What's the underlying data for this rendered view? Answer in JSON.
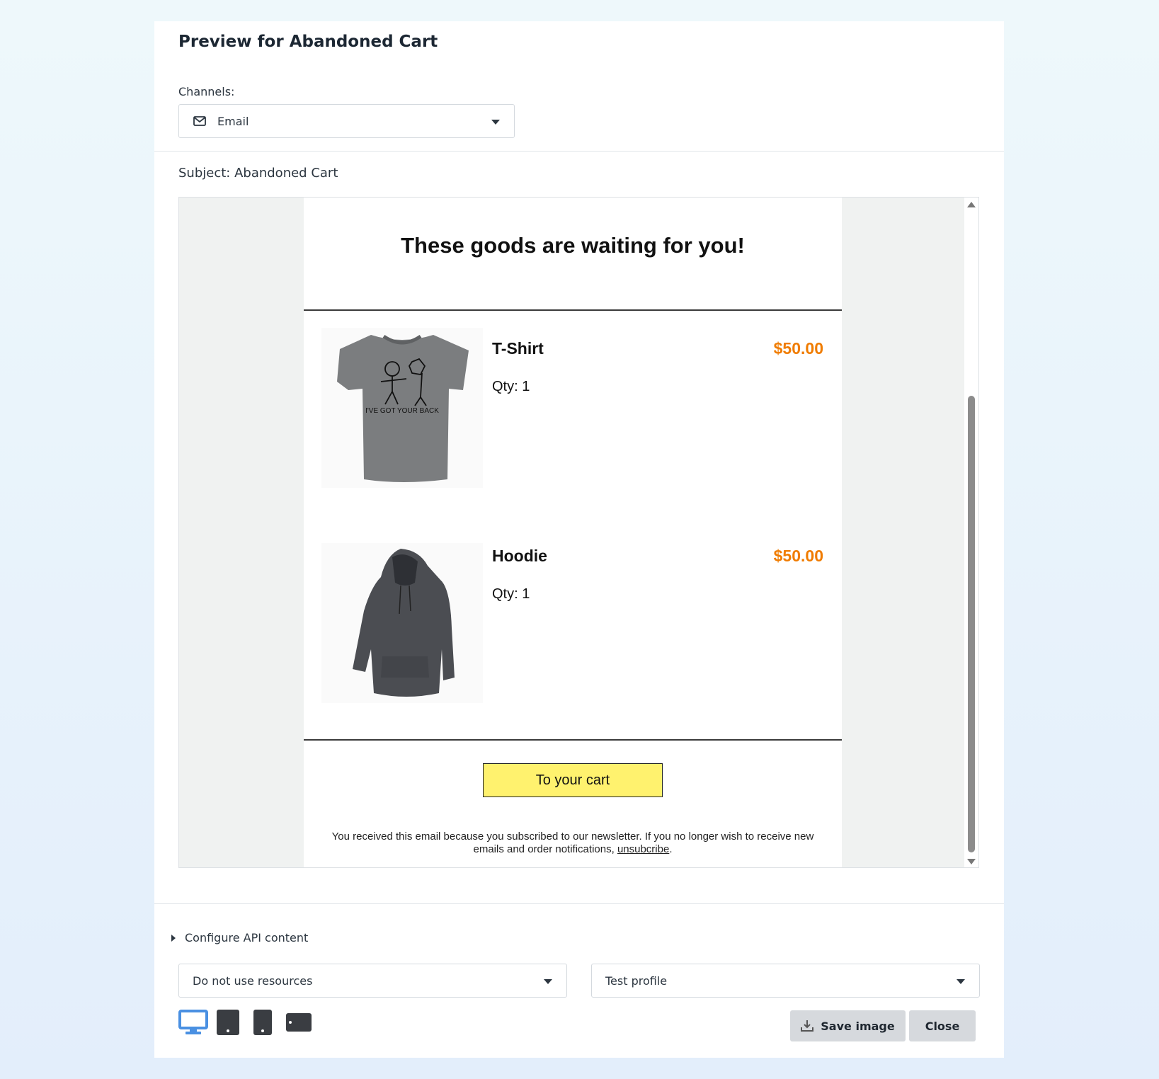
{
  "modal": {
    "title": "Preview for Abandoned Cart",
    "channels_label": "Channels:",
    "channel_selected": "Email",
    "subject": "Subject: Abandoned Cart"
  },
  "email": {
    "heading": "These goods are waiting for you!",
    "products": [
      {
        "name": "T-Shirt",
        "qty": "Qty: 1",
        "price": "$50.00",
        "image_icon": "tshirt-image"
      },
      {
        "name": "Hoodie",
        "qty": "Qty: 1",
        "price": "$50.00",
        "image_icon": "hoodie-image"
      }
    ],
    "cart_button": "To your cart",
    "footer_text": "You received this email because you subscribed to our newsletter. If you no longer wish to receive new emails and order notifications,",
    "unsubscribe_link": "unsubcribe",
    "footer_end": ".",
    "price_color": "#f07c00",
    "button_color": "#fff26e"
  },
  "controls": {
    "api_toggle_label": "Configure API content",
    "resources_selected": "Do not use resources",
    "profile_selected": "Test profile",
    "devices": [
      "desktop",
      "tablet",
      "mobile",
      "mobile-landscape"
    ],
    "active_device": "desktop",
    "active_color": "#4a90e2",
    "save_label": "Save image",
    "close_label": "Close"
  }
}
